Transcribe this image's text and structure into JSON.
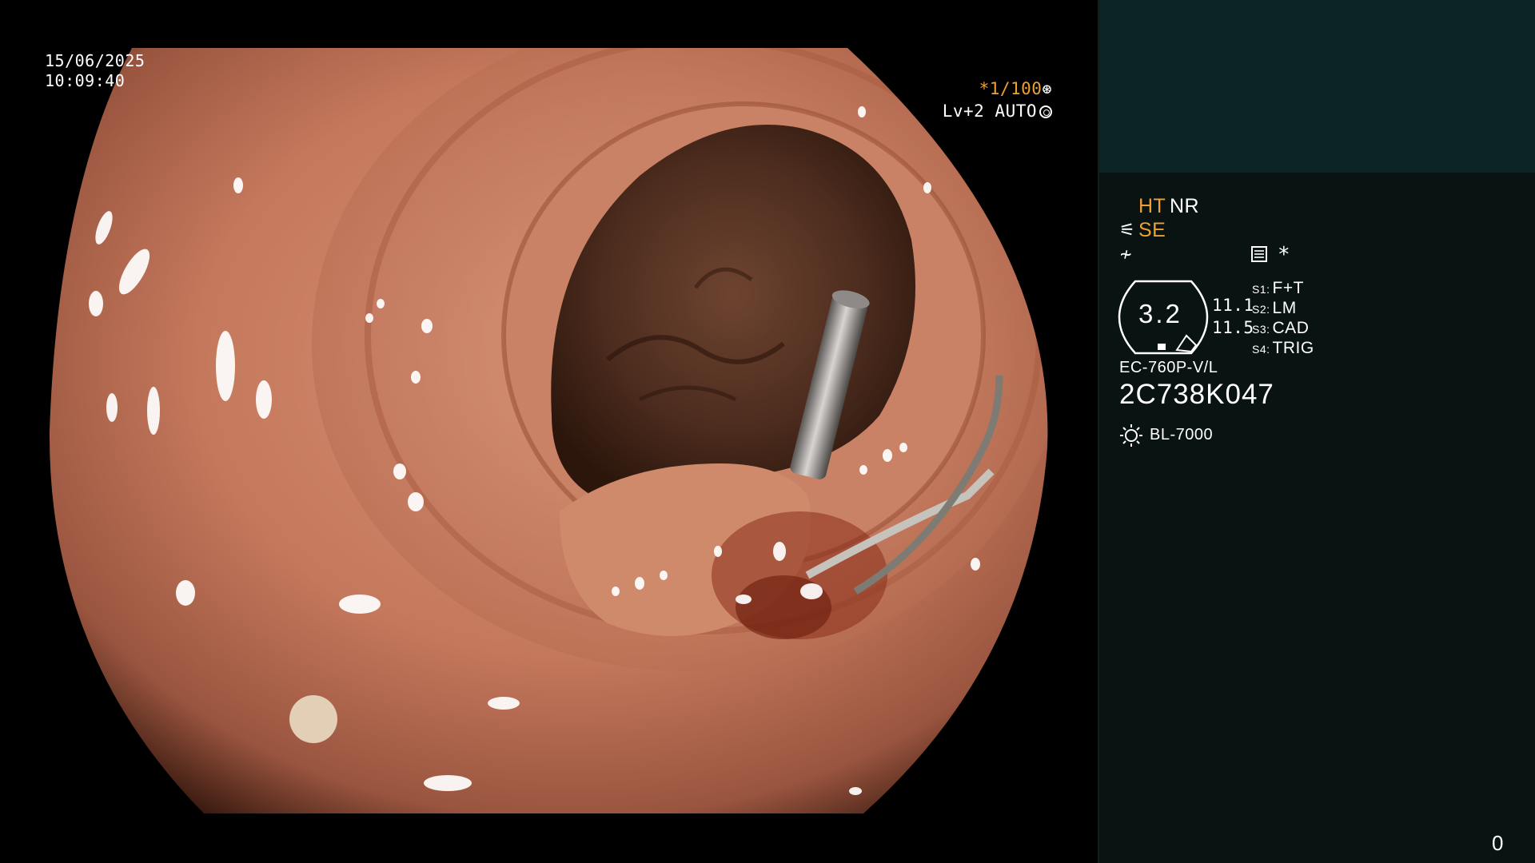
{
  "datetime": {
    "date": "15/06/2025",
    "time": "10:09:40"
  },
  "exposure": {
    "shutter": "*1/100",
    "shutter_icon": "aperture-icon",
    "level": "Lv+2",
    "mode": "AUTO",
    "mode_icon": "iris-icon"
  },
  "panel": {
    "enhance": {
      "ht": "HT",
      "nr": "NR"
    },
    "structure": {
      "se": "SE",
      "icon": "structure-enhance-icon"
    },
    "freeze_icon": "freeze-icon",
    "memo_icon": "memo-icon",
    "star": "*",
    "scope_value": "3.2",
    "numbers": [
      "11.1",
      "11.5"
    ],
    "switches": [
      {
        "key": "S1:",
        "value": "F+T"
      },
      {
        "key": "S2:",
        "value": "LM"
      },
      {
        "key": "S3:",
        "value": "CAD"
      },
      {
        "key": "S4:",
        "value": "TRIG"
      }
    ],
    "model": "EC-760P-V/L",
    "serial": "2C738K047",
    "lamp": {
      "icon": "light-source-icon",
      "label": "BL-7000"
    }
  },
  "counter": "0",
  "colors": {
    "accent": "#f0a030",
    "text": "#ffffff",
    "panel_top": "#0d2426",
    "panel_bottom": "#091312",
    "mucosa": "#c4785c",
    "lumen": "#3e2418"
  }
}
